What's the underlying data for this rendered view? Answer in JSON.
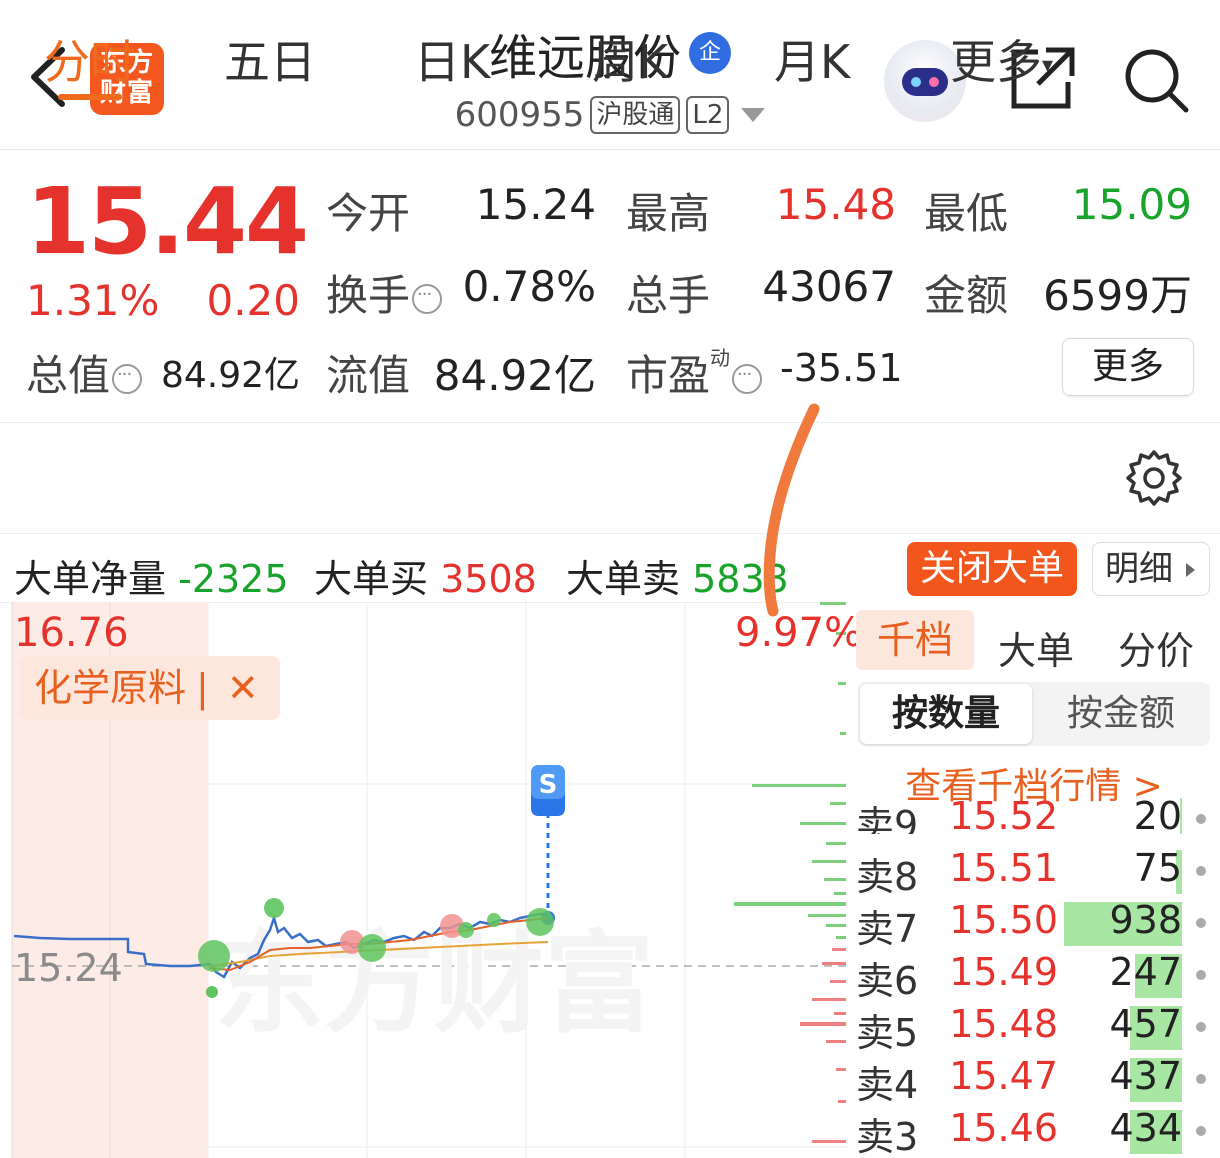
{
  "header": {
    "logo_line1": "东方",
    "logo_line2": "财富",
    "stock_name": "维远股份",
    "badge": "企",
    "stock_code": "600955",
    "tag_connect": "沪股通",
    "tag_level": "L2"
  },
  "quote": {
    "price": "15.44",
    "change_pct": "1.31%",
    "change_abs": "0.20",
    "open_label": "今开",
    "open": "15.24",
    "high_label": "最高",
    "high": "15.48",
    "low_label": "最低",
    "low": "15.09",
    "turnover_label": "换手",
    "turnover": "0.78%",
    "volume_label": "总手",
    "volume": "43067",
    "amount_label": "金额",
    "amount": "6599万",
    "mktcap_label": "总值",
    "mktcap": "84.92亿",
    "float_label": "流值",
    "float_cap": "84.92亿",
    "pe_label": "市盈",
    "pe_sup": "动",
    "pe": "-35.51",
    "more_button": "更多"
  },
  "tabs": [
    "分时",
    "五日",
    "日K",
    "周K",
    "月K",
    "更多"
  ],
  "big_order": {
    "net_label": "大单净量",
    "net": "-2325",
    "buy_label": "大单买",
    "buy": "3508",
    "sell_label": "大单卖",
    "sell": "5833",
    "close_button": "关闭大单",
    "detail_button": "明细"
  },
  "chart": {
    "y_top": "16.76",
    "pct_top": "9.97%",
    "y_mid": "15.24",
    "sector_tag": "化学原料",
    "marker": "S",
    "watermark": "东方财富"
  },
  "side_panel": {
    "tabs": [
      "千档",
      "大单",
      "分价"
    ],
    "seg_active": "按数量",
    "seg_inactive": "按金额",
    "view_link": "查看千档行情 >",
    "rows": [
      {
        "label": "卖9",
        "price": "15.52",
        "vol": "20",
        "fill": 0.02
      },
      {
        "label": "卖8",
        "price": "15.51",
        "vol": "75",
        "fill": 0.05
      },
      {
        "label": "卖7",
        "price": "15.50",
        "vol": "938",
        "fill": 1.0
      },
      {
        "label": "卖6",
        "price": "15.49",
        "vol": "247",
        "fill": 0.4
      },
      {
        "label": "卖5",
        "price": "15.48",
        "vol": "457",
        "fill": 0.44
      },
      {
        "label": "卖4",
        "price": "15.47",
        "vol": "437",
        "fill": 0.44
      },
      {
        "label": "卖3",
        "price": "15.46",
        "vol": "434",
        "fill": 0.44
      }
    ]
  },
  "colors": {
    "up": "#e5322d",
    "down": "#18a32a",
    "accent": "#f06a1e"
  }
}
